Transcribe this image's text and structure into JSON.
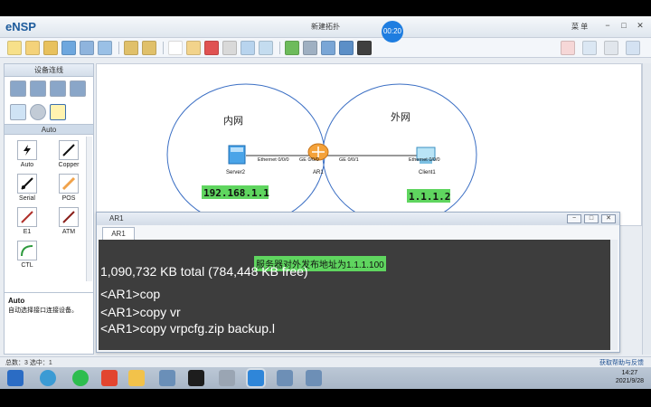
{
  "app": {
    "name": "eNSP",
    "window_title": "新建拓扑",
    "timer": "00:20",
    "menu_label": "菜 单"
  },
  "colors": {
    "accent": "#1e7de0",
    "console_bg": "#3d3d3d",
    "highlight_green": "#5fd55f"
  },
  "left_panel": {
    "title": "设备连线",
    "auto_label": "Auto",
    "cables": [
      {
        "label": "Auto",
        "icon": "lightning-icon"
      },
      {
        "label": "Copper",
        "icon": "copper-cable-icon"
      },
      {
        "label": "Serial",
        "icon": "serial-cable-icon"
      },
      {
        "label": "POS",
        "icon": "pos-cable-icon"
      },
      {
        "label": "E1",
        "icon": "e1-cable-icon"
      },
      {
        "label": "ATM",
        "icon": "atm-cable-icon"
      },
      {
        "label": "CTL",
        "icon": "ctl-cable-icon"
      }
    ],
    "info_title": "Auto",
    "info_desc": "自动选择接口连接设备。"
  },
  "topology": {
    "zone_inner": "内网",
    "zone_outer": "外网",
    "server_label": "Server2",
    "router_label": "AR1",
    "client_label": "Client1",
    "link1_left": "Ethernet 0/0/0",
    "link1_right": "GE 0/0/0",
    "link2_left": "GE 0/0/1",
    "link2_right": "Ethernet 0/0/0",
    "ip_inner": "192.168.1.1",
    "ip_outer": "1.1.1.2"
  },
  "console": {
    "title": "AR1",
    "tab": "AR1",
    "note": "服务器对外发布地址为1.1.1.100",
    "lines": [
      "1,090,732 KB total (784,448 KB free)",
      "<AR1>cop",
      "<AR1>copy vr",
      "<AR1>copy vrpcfg.zip backup.l"
    ]
  },
  "status": {
    "left": "总数：3 选中：1",
    "right": "获取帮助与反馈"
  },
  "taskbar": {
    "time": "14:27",
    "date": "2021/9/28"
  }
}
